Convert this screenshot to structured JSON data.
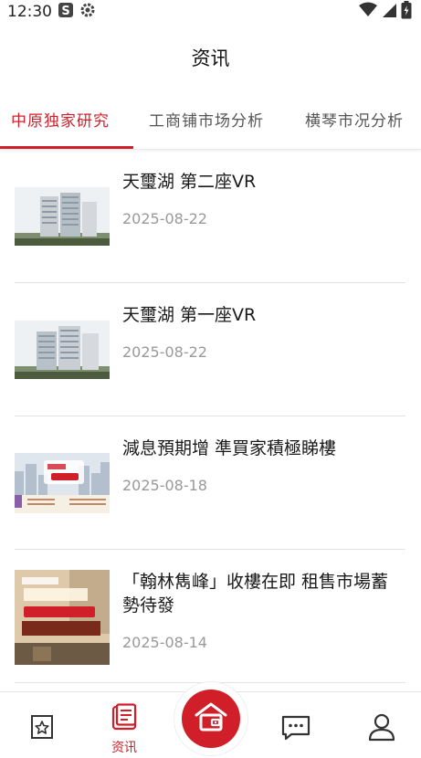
{
  "status_bar": {
    "time": "12:30",
    "icons": [
      "s-app-icon",
      "gear-icon",
      "wifi-icon",
      "signal-icon",
      "battery-icon"
    ]
  },
  "header": {
    "title": "资讯"
  },
  "tabs": [
    {
      "label": "中原独家研究",
      "active": true
    },
    {
      "label": "工商铺市场分析",
      "active": false
    },
    {
      "label": "横琴市况分析",
      "active": false
    }
  ],
  "articles": [
    {
      "title": "天璽湖 第二座VR",
      "date": "2025-08-22",
      "thumb": "building-render"
    },
    {
      "title": "天璽湖 第一座VR",
      "date": "2025-08-22",
      "thumb": "building-render"
    },
    {
      "title": "減息預期增 準買家積極睇樓",
      "date": "2025-08-18",
      "thumb": "market-report"
    },
    {
      "title": "「翰林雋峰」收樓在即 租售市場蓄勢待發",
      "date": "2025-08-14",
      "thumb": "rental-poster"
    }
  ],
  "bottom_nav": [
    {
      "label": "",
      "icon": "star-doc-icon"
    },
    {
      "label": "资讯",
      "icon": "news-icon",
      "active": true
    },
    {
      "label": "",
      "icon": "home-icon"
    },
    {
      "label": "",
      "icon": "chat-icon"
    },
    {
      "label": "",
      "icon": "person-icon"
    }
  ],
  "colors": {
    "accent": "#d11f2a",
    "text": "#1a1a1a",
    "muted": "#999999"
  }
}
